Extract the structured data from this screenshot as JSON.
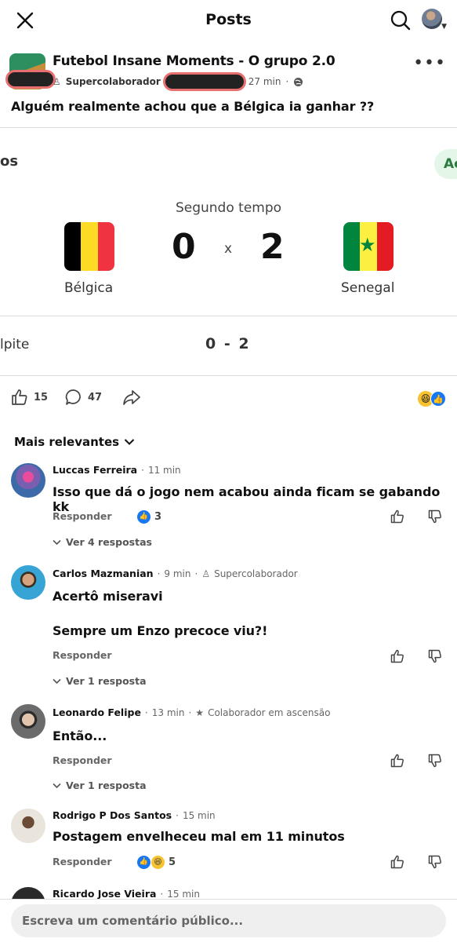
{
  "header": {
    "title": "Posts"
  },
  "post": {
    "group_name": "Futebol Insane Moments - O grupo 2.0",
    "badge": "Supercolaborador",
    "time": "27 min",
    "text": "Alguém realmente achou que a Bélgica ia ganhar  ??"
  },
  "embed": {
    "left_fragment": "os",
    "chip_fragment": "Ac",
    "period": "Segundo tempo",
    "home_team": "Bélgica",
    "away_team": "Senegal",
    "home_score": "0",
    "away_score": "2",
    "separator": "x",
    "guess_label": "lpite",
    "guess_value": "0 - 2",
    "flag_colors": {
      "belgium": [
        "#000000",
        "#FDDA24",
        "#EF3340"
      ],
      "senegal": [
        "#00853F",
        "#FDEF42",
        "#E31B23"
      ]
    }
  },
  "actions": {
    "likes": "15",
    "comments": "47"
  },
  "comments_section": {
    "sort_label": "Mais relevantes"
  },
  "comments": [
    {
      "author": "Luccas Ferreira",
      "time": "11 min",
      "badge": "",
      "text": "Isso que dá o jogo nem acabou ainda ficam se gabando kk",
      "text2": "",
      "reply_label": "Responder",
      "reaction_count": "3",
      "replies_label": "Ver 4 respostas"
    },
    {
      "author": "Carlos Mazmanian",
      "time": "9 min",
      "badge": "Supercolaborador",
      "text": "Acertô miseravi",
      "text2": "Sempre um Enzo precoce viu?!",
      "reply_label": "Responder",
      "reaction_count": "",
      "replies_label": "Ver 1 resposta"
    },
    {
      "author": "Leonardo Felipe",
      "time": "13 min",
      "badge": "Colaborador em ascensão",
      "text": "Então...",
      "text2": "",
      "reply_label": "Responder",
      "reaction_count": "",
      "replies_label": "Ver 1 resposta"
    },
    {
      "author": "Rodrigo P Dos Santos",
      "time": "15 min",
      "badge": "",
      "text": "Postagem envelheceu mal em 11 minutos",
      "text2": "",
      "reply_label": "Responder",
      "reaction_count": "5",
      "replies_label": ""
    },
    {
      "author": "Ricardo Jose Vieira",
      "time": "15 min",
      "badge": "",
      "text": "",
      "text2": "",
      "reply_label": "",
      "reaction_count": "",
      "replies_label": ""
    }
  ],
  "composer": {
    "placeholder": "Escreva um comentário público..."
  },
  "colors": {
    "like_blue": "#1877f2",
    "haha_yellow": "#f7c331",
    "accent_green": "#2b7a3f"
  }
}
